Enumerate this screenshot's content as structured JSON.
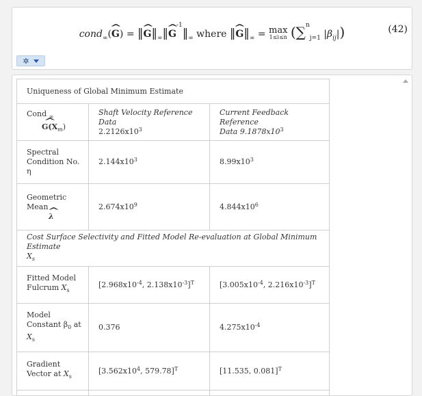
{
  "equation": {
    "lhs_cond": "cond",
    "lhs_sub": "∞",
    "G": "G",
    "where": "where",
    "max_text": "max",
    "max_range": "1≤i≤n",
    "sum_top": "n",
    "sum_bottom": "j=1",
    "beta": "β",
    "beta_sub": "ij",
    "number": "(42)"
  },
  "toolbar": {
    "gear_icon": "gear-icon",
    "dropdown_icon": "chevron-down-icon"
  },
  "table": {
    "caption": "Uniqueness of Global Minimum Estimate",
    "cond_label": "Cond",
    "cond_sub": "∞",
    "cond_G": "G(X",
    "cond_m": "m",
    "cond_close": ")",
    "header_col2_line1": "Shaft Velocity Reference Data",
    "header_col2_value": "2.2126x10",
    "header_col2_exp": "3",
    "header_col3_line1": "Current Feedback Reference",
    "header_col3_line2": "Data 9.1878x10",
    "header_col3_exp": "3",
    "row_spectral": {
      "label_l1": "Spectral",
      "label_l2": "Condition No.",
      "label_l3": "η",
      "v1": "2.144x10",
      "v1_exp": "3",
      "v2": "8.99x10",
      "v2_exp": "3"
    },
    "row_geometric": {
      "label_l1": "Geometric",
      "label_l2": "Mean",
      "label_l3": "λ",
      "v1": "2.674x10",
      "v1_exp": "9",
      "v2": "4.844x10",
      "v2_exp": "6"
    },
    "section2_caption": "Cost Surface Selectivity and Fitted Model Re-evaluation at Global Minimum Estimate",
    "section2_X": "X",
    "section2_Xsub": "s",
    "row_fulcrum": {
      "label_l1": "Fitted Model",
      "label_l2": "Fulcrum",
      "X": "X",
      "Xsub": "s",
      "v1_a": "[2.968x10",
      "v1_a_exp": "-4",
      "v1_b": ", 2.138x10",
      "v1_b_exp": "-3",
      "v1_c": "]",
      "v1_T": "T",
      "v2_a": "[3.005x10",
      "v2_a_exp": "-4",
      "v2_b": ", 2.216x10",
      "v2_b_exp": "-3",
      "v2_c": "]",
      "v2_T": "T"
    },
    "row_constant": {
      "label_l1": "Model",
      "label_l2": "Constant β",
      "label_l2_sub": "0",
      "label_l2_tail": " at",
      "X": "X",
      "Xsub": "s",
      "v1": "0.376",
      "v2": "4.275x10",
      "v2_exp": "-4"
    },
    "row_gradient": {
      "label_l1": "Gradient",
      "label_l2": "Vector at",
      "X": "X",
      "Xsub": "s",
      "v1_a": "[3.562x10",
      "v1_a_exp": "4",
      "v1_b": ", 579.78]",
      "v1_T": "T",
      "v2": "[11.535, 0.081]",
      "v2_T": "T"
    }
  }
}
